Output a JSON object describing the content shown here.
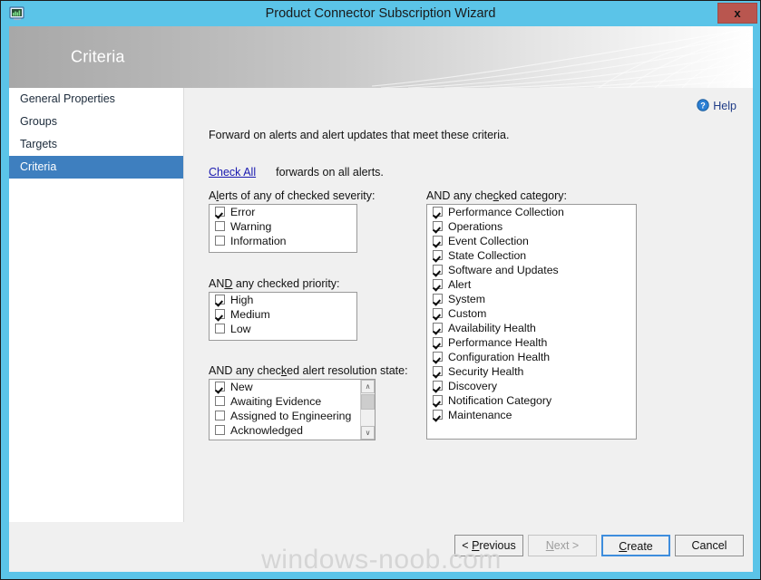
{
  "window": {
    "title": "Product Connector Subscription Wizard",
    "icon": "monitor-chart-icon",
    "close_label": "x",
    "titlebar_color": "#5bc4e8",
    "close_color": "#b9564f"
  },
  "banner": {
    "heading": "Criteria"
  },
  "sidebar": {
    "items": [
      {
        "label": "General Properties",
        "selected": false
      },
      {
        "label": "Groups",
        "selected": false
      },
      {
        "label": "Targets",
        "selected": false
      },
      {
        "label": "Criteria",
        "selected": true
      }
    ],
    "selected_color": "#3e7fbf"
  },
  "help": {
    "label": "Help",
    "icon": "help-question-icon",
    "color": "#1f3c87"
  },
  "main": {
    "intro": "Forward on alerts and alert updates that meet these criteria.",
    "check_all_link": "Check All",
    "check_all_text": "forwards on all alerts.",
    "link_color": "#1a1ab0",
    "severity": {
      "label_pre": "A",
      "label_accel": "l",
      "label_post": "erts of any of checked severity:",
      "items": [
        {
          "label": "Error",
          "checked": true
        },
        {
          "label": "Warning",
          "checked": false
        },
        {
          "label": "Information",
          "checked": false
        }
      ]
    },
    "priority": {
      "label_pre": "AN",
      "label_accel": "D",
      "label_post": " any checked priority:",
      "items": [
        {
          "label": "High",
          "checked": true
        },
        {
          "label": "Medium",
          "checked": true
        },
        {
          "label": "Low",
          "checked": false
        }
      ]
    },
    "resolution_state": {
      "label_pre": "AND any chec",
      "label_accel": "k",
      "label_post": "ed alert resolution state:",
      "items": [
        {
          "label": "New",
          "checked": true
        },
        {
          "label": "Awaiting Evidence",
          "checked": false
        },
        {
          "label": "Assigned to Engineering",
          "checked": false
        },
        {
          "label": "Acknowledged",
          "checked": false
        }
      ],
      "scrollbar": {
        "up": "∧",
        "down": "∨"
      }
    },
    "category": {
      "label_pre": "AND any che",
      "label_accel": "c",
      "label_post": "ked category:",
      "items": [
        {
          "label": "Performance Collection",
          "checked": true
        },
        {
          "label": "Operations",
          "checked": true
        },
        {
          "label": "Event Collection",
          "checked": true
        },
        {
          "label": "State Collection",
          "checked": true
        },
        {
          "label": "Software and Updates",
          "checked": true
        },
        {
          "label": "Alert",
          "checked": true
        },
        {
          "label": "System",
          "checked": true
        },
        {
          "label": "Custom",
          "checked": true
        },
        {
          "label": "Availability Health",
          "checked": true
        },
        {
          "label": "Performance Health",
          "checked": true
        },
        {
          "label": "Configuration Health",
          "checked": true
        },
        {
          "label": "Security Health",
          "checked": true
        },
        {
          "label": "Discovery",
          "checked": true
        },
        {
          "label": "Notification Category",
          "checked": true
        },
        {
          "label": "Maintenance",
          "checked": true
        }
      ]
    }
  },
  "footer": {
    "buttons": [
      {
        "pre": "< ",
        "accel": "P",
        "post": "revious",
        "state": "normal"
      },
      {
        "pre": "",
        "accel": "N",
        "post": "ext >",
        "state": "disabled"
      },
      {
        "pre": "",
        "accel": "C",
        "post": "reate",
        "state": "default"
      },
      {
        "pre": "Cancel",
        "accel": "",
        "post": "",
        "state": "normal"
      }
    ]
  },
  "watermark": "windows-noob.com"
}
